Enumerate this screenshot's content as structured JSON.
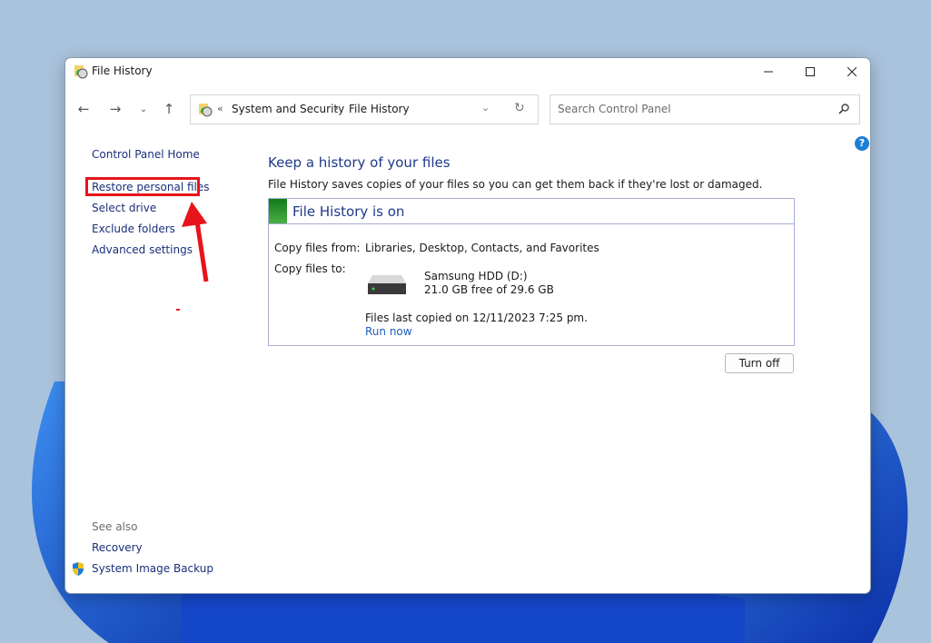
{
  "window": {
    "title": "File History",
    "controls": {
      "minimize": "minimize",
      "maximize": "maximize",
      "close": "close"
    }
  },
  "navbar": {
    "back_icon": "arrow-left-icon",
    "forward_icon": "arrow-right-icon",
    "recent_icon": "chevron-down-icon",
    "up_icon": "arrow-up-icon",
    "address": {
      "overflow": "«",
      "breadcrumbs": [
        "System and Security",
        "File History"
      ],
      "separator": "›"
    },
    "search": {
      "placeholder": "Search Control Panel",
      "value": ""
    }
  },
  "sidebar": {
    "home": "Control Panel Home",
    "links": [
      "Restore personal files",
      "Select drive",
      "Exclude folders",
      "Advanced settings"
    ],
    "see_also_heading": "See also",
    "see_also": [
      "Recovery",
      "System Image Backup"
    ]
  },
  "annotation": {
    "highlighted_item": "Restore personal files",
    "highlight_color": "#e8141b"
  },
  "main": {
    "title": "Keep a history of your files",
    "description": "File History saves copies of your files so you can get them back if they're lost or damaged.",
    "status": {
      "title": "File History is on",
      "color": "#2e9a2e",
      "copy_from_label": "Copy files from:",
      "copy_from_value": "Libraries, Desktop, Contacts, and Favorites",
      "copy_to_label": "Copy files to:",
      "drive_name": "Samsung HDD (D:)",
      "drive_space": "21.0 GB free of 29.6 GB",
      "last_copied": "Files last copied on 12/11/2023 7:25 pm.",
      "run_now": "Run now"
    },
    "turn_off": "Turn off"
  },
  "help": "?"
}
